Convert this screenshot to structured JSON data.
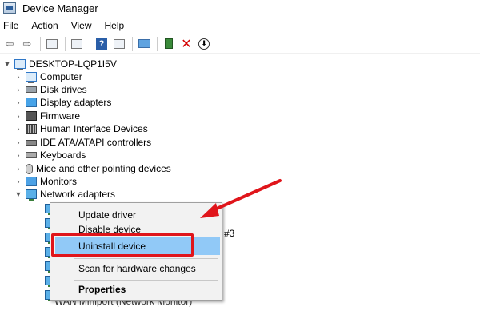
{
  "window": {
    "title": "Device Manager"
  },
  "menu": [
    "File",
    "Action",
    "View",
    "Help"
  ],
  "toolbar": {
    "icons": [
      "back-arrow-icon",
      "forward-arrow-icon",
      "properties-icon",
      "list-icon",
      "help-icon",
      "panel-icon",
      "scan-monitor-icon",
      "update-driver-icon",
      "uninstall-x-icon",
      "download-icon"
    ]
  },
  "tree": {
    "root": "DESKTOP-LQP1I5V",
    "categories": [
      {
        "label": "Computer",
        "icon": "computer-icon"
      },
      {
        "label": "Disk drives",
        "icon": "disk-icon"
      },
      {
        "label": "Display adapters",
        "icon": "display-icon"
      },
      {
        "label": "Firmware",
        "icon": "firmware-icon"
      },
      {
        "label": "Human Interface Devices",
        "icon": "hid-icon"
      },
      {
        "label": "IDE ATA/ATAPI controllers",
        "icon": "ide-icon"
      },
      {
        "label": "Keyboards",
        "icon": "keyboard-icon"
      },
      {
        "label": "Mice and other pointing devices",
        "icon": "mouse-icon"
      },
      {
        "label": "Monitors",
        "icon": "monitor-icon"
      },
      {
        "label": "Network adapters",
        "icon": "network-icon"
      }
    ],
    "partial_suffix": "#3",
    "bottom_partial": "WAN Miniport (Network Monitor)"
  },
  "context_menu": {
    "items": [
      "Update driver",
      "Disable device",
      "Uninstall device",
      "Scan for hardware changes",
      "Properties"
    ],
    "highlighted": "Uninstall device"
  },
  "colors": {
    "highlight": "#91c9f7",
    "annotation": "#e0151b"
  }
}
